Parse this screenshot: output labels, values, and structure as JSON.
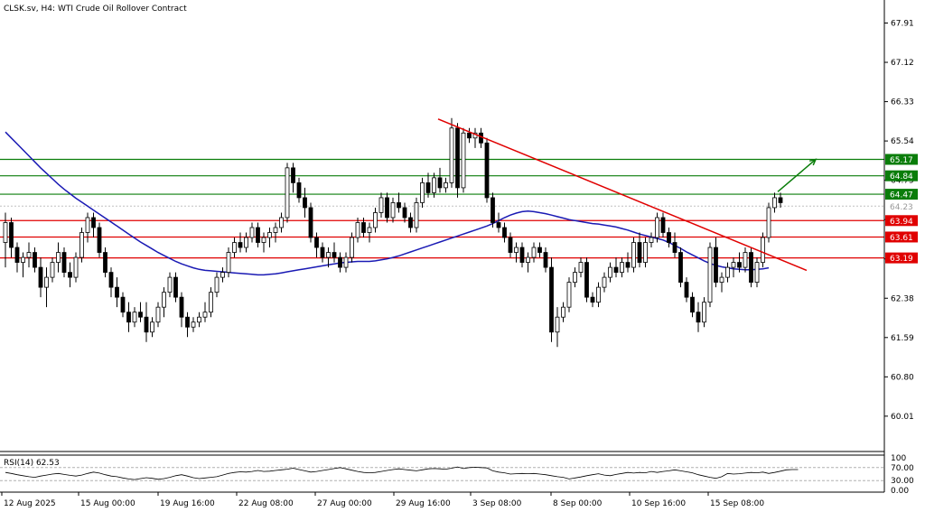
{
  "header": {
    "symbol": "CLSK.sv",
    "timeframe": "H4",
    "description": "WTI Crude Oil Rollover Contract"
  },
  "chart_data": {
    "type": "candlestick",
    "ylim": [
      59.3,
      68.3
    ],
    "y_ticks": [
      "67.91",
      "67.12",
      "66.33",
      "65.54",
      "64.75",
      "63.96",
      "63.17",
      "62.38",
      "61.59",
      "60.80",
      "60.01"
    ],
    "x_ticks": [
      "12 Aug 2025",
      "15 Aug 00:00",
      "19 Aug 16:00",
      "22 Aug 08:00",
      "27 Aug 00:00",
      "29 Aug 16:00",
      "3 Sep 08:00",
      "8 Sep 00:00",
      "10 Sep 16:00",
      "15 Sep 08:00"
    ],
    "current_price": "64.23",
    "levels": [
      {
        "value": 65.17,
        "label": "65.17",
        "color": "#0a7d0a"
      },
      {
        "value": 64.84,
        "label": "64.84",
        "color": "#0a7d0a"
      },
      {
        "value": 64.47,
        "label": "64.47",
        "color": "#0a7d0a"
      },
      {
        "value": 63.94,
        "label": "63.94",
        "color": "#e00000"
      },
      {
        "value": 63.61,
        "label": "63.61",
        "color": "#e00000"
      },
      {
        "value": 63.19,
        "label": "63.19",
        "color": "#e00000"
      }
    ],
    "trendline": {
      "start": {
        "x": 485,
        "y": 65.98
      },
      "end": {
        "x": 893,
        "y": 62.94
      },
      "color": "#e00000"
    },
    "arrow": {
      "start": {
        "x": 861,
        "y": 64.52
      },
      "end": {
        "x": 903,
        "y": 65.17
      },
      "color": "#0a7d0a"
    },
    "candles": [
      {
        "o": 63.5,
        "h": 64.1,
        "l": 63.0,
        "c": 63.9
      },
      {
        "o": 63.9,
        "h": 64.0,
        "l": 63.2,
        "c": 63.4
      },
      {
        "o": 63.4,
        "h": 63.5,
        "l": 62.9,
        "c": 63.1
      },
      {
        "o": 63.1,
        "h": 63.3,
        "l": 62.8,
        "c": 63.2
      },
      {
        "o": 63.2,
        "h": 63.5,
        "l": 63.0,
        "c": 63.3
      },
      {
        "o": 63.3,
        "h": 63.4,
        "l": 62.9,
        "c": 63.0
      },
      {
        "o": 63.0,
        "h": 63.2,
        "l": 62.4,
        "c": 62.6
      },
      {
        "o": 62.6,
        "h": 63.0,
        "l": 62.2,
        "c": 62.8
      },
      {
        "o": 62.8,
        "h": 63.2,
        "l": 62.7,
        "c": 63.1
      },
      {
        "o": 63.1,
        "h": 63.5,
        "l": 62.9,
        "c": 63.3
      },
      {
        "o": 63.3,
        "h": 63.4,
        "l": 62.8,
        "c": 62.9
      },
      {
        "o": 62.9,
        "h": 63.1,
        "l": 62.6,
        "c": 62.8
      },
      {
        "o": 62.8,
        "h": 63.3,
        "l": 62.7,
        "c": 63.2
      },
      {
        "o": 63.2,
        "h": 63.8,
        "l": 63.1,
        "c": 63.7
      },
      {
        "o": 63.7,
        "h": 64.1,
        "l": 63.5,
        "c": 64.0
      },
      {
        "o": 64.0,
        "h": 64.1,
        "l": 63.6,
        "c": 63.8
      },
      {
        "o": 63.8,
        "h": 63.9,
        "l": 63.2,
        "c": 63.3
      },
      {
        "o": 63.3,
        "h": 63.4,
        "l": 62.8,
        "c": 62.9
      },
      {
        "o": 62.9,
        "h": 63.0,
        "l": 62.4,
        "c": 62.6
      },
      {
        "o": 62.6,
        "h": 62.8,
        "l": 62.2,
        "c": 62.4
      },
      {
        "o": 62.4,
        "h": 62.5,
        "l": 62.0,
        "c": 62.1
      },
      {
        "o": 62.1,
        "h": 62.3,
        "l": 61.7,
        "c": 61.9
      },
      {
        "o": 61.9,
        "h": 62.2,
        "l": 61.8,
        "c": 62.1
      },
      {
        "o": 62.1,
        "h": 62.3,
        "l": 61.9,
        "c": 62.0
      },
      {
        "o": 62.0,
        "h": 62.3,
        "l": 61.5,
        "c": 61.7
      },
      {
        "o": 61.7,
        "h": 62.0,
        "l": 61.6,
        "c": 61.9
      },
      {
        "o": 61.9,
        "h": 62.3,
        "l": 61.8,
        "c": 62.2
      },
      {
        "o": 62.2,
        "h": 62.6,
        "l": 62.0,
        "c": 62.5
      },
      {
        "o": 62.5,
        "h": 62.9,
        "l": 62.4,
        "c": 62.8
      },
      {
        "o": 62.8,
        "h": 62.9,
        "l": 62.3,
        "c": 62.4
      },
      {
        "o": 62.4,
        "h": 62.5,
        "l": 61.8,
        "c": 62.0
      },
      {
        "o": 62.0,
        "h": 62.1,
        "l": 61.6,
        "c": 61.8
      },
      {
        "o": 61.8,
        "h": 62.0,
        "l": 61.7,
        "c": 61.9
      },
      {
        "o": 61.9,
        "h": 62.1,
        "l": 61.8,
        "c": 62.0
      },
      {
        "o": 62.0,
        "h": 62.3,
        "l": 61.9,
        "c": 62.1
      },
      {
        "o": 62.1,
        "h": 62.6,
        "l": 62.0,
        "c": 62.5
      },
      {
        "o": 62.5,
        "h": 62.9,
        "l": 62.4,
        "c": 62.8
      },
      {
        "o": 62.8,
        "h": 63.0,
        "l": 62.7,
        "c": 62.9
      },
      {
        "o": 62.9,
        "h": 63.4,
        "l": 62.8,
        "c": 63.3
      },
      {
        "o": 63.3,
        "h": 63.6,
        "l": 63.2,
        "c": 63.5
      },
      {
        "o": 63.5,
        "h": 63.7,
        "l": 63.3,
        "c": 63.4
      },
      {
        "o": 63.4,
        "h": 63.7,
        "l": 63.3,
        "c": 63.6
      },
      {
        "o": 63.6,
        "h": 63.9,
        "l": 63.5,
        "c": 63.8
      },
      {
        "o": 63.8,
        "h": 63.9,
        "l": 63.4,
        "c": 63.5
      },
      {
        "o": 63.5,
        "h": 63.7,
        "l": 63.3,
        "c": 63.6
      },
      {
        "o": 63.6,
        "h": 63.8,
        "l": 63.4,
        "c": 63.7
      },
      {
        "o": 63.7,
        "h": 63.9,
        "l": 63.5,
        "c": 63.8
      },
      {
        "o": 63.8,
        "h": 64.1,
        "l": 63.7,
        "c": 64.0
      },
      {
        "o": 64.0,
        "h": 65.1,
        "l": 63.9,
        "c": 65.0
      },
      {
        "o": 65.0,
        "h": 65.1,
        "l": 64.5,
        "c": 64.7
      },
      {
        "o": 64.7,
        "h": 64.8,
        "l": 64.3,
        "c": 64.4
      },
      {
        "o": 64.4,
        "h": 64.6,
        "l": 64.0,
        "c": 64.2
      },
      {
        "o": 64.2,
        "h": 64.3,
        "l": 63.5,
        "c": 63.6
      },
      {
        "o": 63.6,
        "h": 63.7,
        "l": 63.2,
        "c": 63.4
      },
      {
        "o": 63.4,
        "h": 63.5,
        "l": 63.1,
        "c": 63.2
      },
      {
        "o": 63.2,
        "h": 63.4,
        "l": 63.0,
        "c": 63.3
      },
      {
        "o": 63.3,
        "h": 63.5,
        "l": 63.1,
        "c": 63.2
      },
      {
        "o": 63.2,
        "h": 63.3,
        "l": 62.9,
        "c": 63.0
      },
      {
        "o": 63.0,
        "h": 63.3,
        "l": 62.9,
        "c": 63.2
      },
      {
        "o": 63.2,
        "h": 63.7,
        "l": 63.1,
        "c": 63.6
      },
      {
        "o": 63.6,
        "h": 64.0,
        "l": 63.5,
        "c": 63.9
      },
      {
        "o": 63.9,
        "h": 64.0,
        "l": 63.6,
        "c": 63.7
      },
      {
        "o": 63.7,
        "h": 63.9,
        "l": 63.5,
        "c": 63.8
      },
      {
        "o": 63.8,
        "h": 64.2,
        "l": 63.7,
        "c": 64.1
      },
      {
        "o": 64.1,
        "h": 64.5,
        "l": 64.0,
        "c": 64.4
      },
      {
        "o": 64.4,
        "h": 64.5,
        "l": 63.9,
        "c": 64.0
      },
      {
        "o": 64.0,
        "h": 64.4,
        "l": 63.9,
        "c": 64.3
      },
      {
        "o": 64.3,
        "h": 64.5,
        "l": 64.1,
        "c": 64.2
      },
      {
        "o": 64.2,
        "h": 64.3,
        "l": 63.9,
        "c": 64.0
      },
      {
        "o": 64.0,
        "h": 64.1,
        "l": 63.7,
        "c": 63.8
      },
      {
        "o": 63.8,
        "h": 64.4,
        "l": 63.7,
        "c": 64.3
      },
      {
        "o": 64.3,
        "h": 64.8,
        "l": 64.2,
        "c": 64.7
      },
      {
        "o": 64.7,
        "h": 64.9,
        "l": 64.4,
        "c": 64.5
      },
      {
        "o": 64.5,
        "h": 64.9,
        "l": 64.4,
        "c": 64.8
      },
      {
        "o": 64.8,
        "h": 65.0,
        "l": 64.5,
        "c": 64.6
      },
      {
        "o": 64.6,
        "h": 64.8,
        "l": 64.5,
        "c": 64.7
      },
      {
        "o": 64.7,
        "h": 66.0,
        "l": 64.6,
        "c": 65.8
      },
      {
        "o": 65.8,
        "h": 65.9,
        "l": 64.4,
        "c": 64.6
      },
      {
        "o": 64.6,
        "h": 65.8,
        "l": 64.5,
        "c": 65.7
      },
      {
        "o": 65.7,
        "h": 65.8,
        "l": 65.5,
        "c": 65.6
      },
      {
        "o": 65.6,
        "h": 65.8,
        "l": 65.4,
        "c": 65.7
      },
      {
        "o": 65.7,
        "h": 65.8,
        "l": 65.4,
        "c": 65.5
      },
      {
        "o": 65.5,
        "h": 65.6,
        "l": 64.3,
        "c": 64.4
      },
      {
        "o": 64.4,
        "h": 64.5,
        "l": 63.8,
        "c": 63.9
      },
      {
        "o": 63.9,
        "h": 64.1,
        "l": 63.7,
        "c": 63.8
      },
      {
        "o": 63.8,
        "h": 63.9,
        "l": 63.5,
        "c": 63.6
      },
      {
        "o": 63.6,
        "h": 63.7,
        "l": 63.2,
        "c": 63.3
      },
      {
        "o": 63.3,
        "h": 63.5,
        "l": 63.1,
        "c": 63.4
      },
      {
        "o": 63.4,
        "h": 63.5,
        "l": 63.0,
        "c": 63.1
      },
      {
        "o": 63.1,
        "h": 63.3,
        "l": 62.9,
        "c": 63.2
      },
      {
        "o": 63.2,
        "h": 63.5,
        "l": 63.1,
        "c": 63.4
      },
      {
        "o": 63.4,
        "h": 63.5,
        "l": 63.2,
        "c": 63.3
      },
      {
        "o": 63.3,
        "h": 63.4,
        "l": 62.9,
        "c": 63.0
      },
      {
        "o": 63.0,
        "h": 63.2,
        "l": 61.5,
        "c": 61.7
      },
      {
        "o": 61.7,
        "h": 62.2,
        "l": 61.4,
        "c": 62.0
      },
      {
        "o": 62.0,
        "h": 62.3,
        "l": 61.9,
        "c": 62.2
      },
      {
        "o": 62.2,
        "h": 62.8,
        "l": 62.1,
        "c": 62.7
      },
      {
        "o": 62.7,
        "h": 63.0,
        "l": 62.6,
        "c": 62.9
      },
      {
        "o": 62.9,
        "h": 63.2,
        "l": 62.8,
        "c": 63.1
      },
      {
        "o": 63.1,
        "h": 63.2,
        "l": 62.3,
        "c": 62.4
      },
      {
        "o": 62.4,
        "h": 62.5,
        "l": 62.2,
        "c": 62.3
      },
      {
        "o": 62.3,
        "h": 62.7,
        "l": 62.2,
        "c": 62.6
      },
      {
        "o": 62.6,
        "h": 62.9,
        "l": 62.5,
        "c": 62.8
      },
      {
        "o": 62.8,
        "h": 63.1,
        "l": 62.7,
        "c": 63.0
      },
      {
        "o": 63.0,
        "h": 63.2,
        "l": 62.8,
        "c": 62.9
      },
      {
        "o": 62.9,
        "h": 63.2,
        "l": 62.8,
        "c": 63.1
      },
      {
        "o": 63.1,
        "h": 63.3,
        "l": 62.9,
        "c": 63.0
      },
      {
        "o": 63.0,
        "h": 63.6,
        "l": 62.9,
        "c": 63.5
      },
      {
        "o": 63.5,
        "h": 63.7,
        "l": 63.0,
        "c": 63.1
      },
      {
        "o": 63.1,
        "h": 63.6,
        "l": 63.0,
        "c": 63.5
      },
      {
        "o": 63.5,
        "h": 63.7,
        "l": 63.4,
        "c": 63.6
      },
      {
        "o": 63.6,
        "h": 64.1,
        "l": 63.5,
        "c": 64.0
      },
      {
        "o": 64.0,
        "h": 64.1,
        "l": 63.6,
        "c": 63.7
      },
      {
        "o": 63.7,
        "h": 63.8,
        "l": 63.4,
        "c": 63.5
      },
      {
        "o": 63.5,
        "h": 63.7,
        "l": 63.2,
        "c": 63.3
      },
      {
        "o": 63.3,
        "h": 63.4,
        "l": 62.6,
        "c": 62.7
      },
      {
        "o": 62.7,
        "h": 62.8,
        "l": 62.3,
        "c": 62.4
      },
      {
        "o": 62.4,
        "h": 62.5,
        "l": 62.0,
        "c": 62.1
      },
      {
        "o": 62.1,
        "h": 62.3,
        "l": 61.7,
        "c": 61.9
      },
      {
        "o": 61.9,
        "h": 62.4,
        "l": 61.8,
        "c": 62.3
      },
      {
        "o": 62.3,
        "h": 63.5,
        "l": 62.2,
        "c": 63.4
      },
      {
        "o": 63.4,
        "h": 63.6,
        "l": 62.6,
        "c": 62.7
      },
      {
        "o": 62.7,
        "h": 62.9,
        "l": 62.5,
        "c": 62.8
      },
      {
        "o": 62.8,
        "h": 63.1,
        "l": 62.7,
        "c": 63.0
      },
      {
        "o": 63.0,
        "h": 63.2,
        "l": 62.8,
        "c": 63.1
      },
      {
        "o": 63.1,
        "h": 63.3,
        "l": 62.9,
        "c": 63.0
      },
      {
        "o": 63.0,
        "h": 63.4,
        "l": 62.9,
        "c": 63.3
      },
      {
        "o": 63.3,
        "h": 63.4,
        "l": 62.6,
        "c": 62.7
      },
      {
        "o": 62.7,
        "h": 63.2,
        "l": 62.6,
        "c": 63.1
      },
      {
        "o": 63.1,
        "h": 63.7,
        "l": 63.0,
        "c": 63.6
      },
      {
        "o": 63.6,
        "h": 64.3,
        "l": 63.5,
        "c": 64.2
      },
      {
        "o": 64.2,
        "h": 64.5,
        "l": 64.1,
        "c": 64.4
      },
      {
        "o": 64.4,
        "h": 64.5,
        "l": 64.2,
        "c": 64.3
      }
    ],
    "sma": [
      65.72,
      65.6,
      65.48,
      65.36,
      65.24,
      65.12,
      65.0,
      64.89,
      64.78,
      64.67,
      64.57,
      64.48,
      64.39,
      64.31,
      64.23,
      64.15,
      64.07,
      63.99,
      63.91,
      63.83,
      63.75,
      63.67,
      63.59,
      63.51,
      63.44,
      63.37,
      63.3,
      63.24,
      63.18,
      63.12,
      63.07,
      63.03,
      62.99,
      62.96,
      62.94,
      62.93,
      62.92,
      62.91,
      62.9,
      62.89,
      62.88,
      62.87,
      62.86,
      62.85,
      62.85,
      62.86,
      62.87,
      62.89,
      62.91,
      62.93,
      62.95,
      62.97,
      62.99,
      63.01,
      63.03,
      63.05,
      63.07,
      63.09,
      63.1,
      63.11,
      63.12,
      63.12,
      63.12,
      63.13,
      63.15,
      63.17,
      63.2,
      63.23,
      63.27,
      63.31,
      63.35,
      63.39,
      63.43,
      63.47,
      63.51,
      63.55,
      63.59,
      63.63,
      63.67,
      63.71,
      63.75,
      63.79,
      63.83,
      63.88,
      63.94,
      64.0,
      64.05,
      64.09,
      64.12,
      64.13,
      64.12,
      64.1,
      64.08,
      64.05,
      64.02,
      63.99,
      63.96,
      63.94,
      63.92,
      63.9,
      63.88,
      63.87,
      63.85,
      63.83,
      63.81,
      63.78,
      63.75,
      63.71,
      63.67,
      63.64,
      63.61,
      63.58,
      63.55,
      63.5,
      63.44,
      63.38,
      63.31,
      63.25,
      63.19,
      63.13,
      63.08,
      63.04,
      63.01,
      62.99,
      62.97,
      62.96,
      62.95,
      62.95,
      62.96,
      62.97,
      62.99
    ],
    "rsi": {
      "label": "RSI(14) 62.53",
      "ylim": [
        0,
        100
      ],
      "ticks": [
        "100",
        "70.00",
        "30.00",
        "0.00"
      ],
      "values": [
        55,
        52,
        48,
        45,
        42,
        40,
        44,
        47,
        50,
        52,
        49,
        46,
        44,
        47,
        52,
        56,
        53,
        48,
        44,
        42,
        38,
        35,
        33,
        36,
        39,
        37,
        34,
        36,
        40,
        45,
        48,
        44,
        39,
        36,
        38,
        40,
        42,
        47,
        52,
        55,
        57,
        56,
        58,
        61,
        58,
        59,
        61,
        63,
        65,
        68,
        64,
        60,
        56,
        58,
        61,
        64,
        67,
        70,
        66,
        62,
        58,
        55,
        54,
        55,
        58,
        61,
        64,
        66,
        64,
        62,
        60,
        63,
        66,
        67,
        66,
        65,
        68,
        72,
        67,
        70,
        71,
        70,
        69,
        60,
        56,
        54,
        50,
        51,
        52,
        51,
        52,
        50,
        48,
        45,
        42,
        40,
        35,
        38,
        41,
        45,
        48,
        51,
        47,
        45,
        49,
        52,
        55,
        53,
        55,
        54,
        58,
        55,
        58,
        60,
        63,
        60,
        57,
        54,
        48,
        44,
        40,
        37,
        42,
        52,
        50,
        51,
        53,
        55,
        54,
        56,
        52,
        55,
        59,
        63,
        64,
        64
      ]
    }
  }
}
